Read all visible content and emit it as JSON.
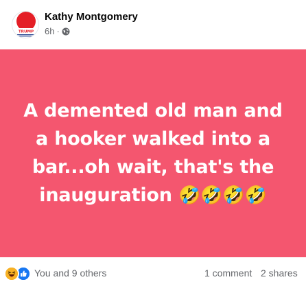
{
  "post": {
    "author": "Kathy Montgomery",
    "timestamp": "6h",
    "separator": "·",
    "privacy_icon": "globe-icon",
    "avatar_text": "TRUMP",
    "background_color": "#f4566f",
    "text": "A demented old man and a hooker walked into a bar...oh wait, that's the inauguration",
    "text_emoji": "🤣🤣🤣🤣"
  },
  "footer": {
    "reaction_icons": [
      "haha-icon",
      "like-icon"
    ],
    "reaction_count": "You and 9 others",
    "comments": "1 comment",
    "shares": "2 shares"
  },
  "colors": {
    "accent": "#1877f2",
    "secondary_text": "#65676b",
    "avatar_red": "#e41e26"
  }
}
